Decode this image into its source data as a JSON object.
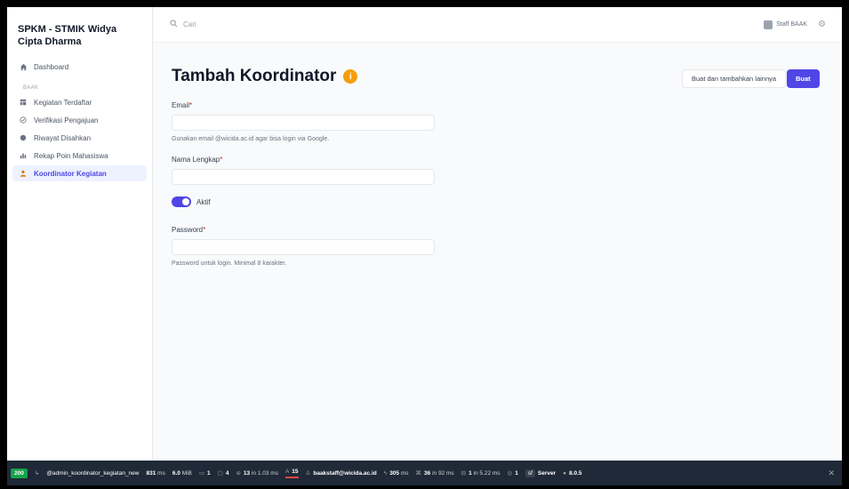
{
  "app": {
    "brand": "SPKM - STMIK Widya Cipta Dharma"
  },
  "sidebar": {
    "dashboard": "Dashboard",
    "group": "BAAK",
    "items": [
      {
        "label": "Kegiatan Terdaftar",
        "icon": "table-icon"
      },
      {
        "label": "Verifikasi Pengajuan",
        "icon": "check-badge-icon"
      },
      {
        "label": "Riwayat Disahkan",
        "icon": "history-icon"
      },
      {
        "label": "Rekap Poin Mahasiswa",
        "icon": "bar-chart-icon"
      },
      {
        "label": "Koordinator Kegiatan",
        "icon": "user-icon",
        "active": true
      }
    ]
  },
  "topbar": {
    "search_placeholder": "Cari",
    "user_name": "Staff BAAK"
  },
  "page": {
    "title": "Tambah Koordinator",
    "btn_create_another": "Buat dan tambahkan lainnya",
    "btn_create": "Buat",
    "email_label": "Email",
    "email_hint": "Gunakan email @wicida.ac.id agar bisa login via Google.",
    "name_label": "Nama Lengkap",
    "toggle_label": "Aktif",
    "toggle_on": true,
    "password_label": "Password",
    "password_hint": "Password untuk login. Minimal 8 karakter."
  },
  "debugbar": {
    "status": "200",
    "route": "@admin_koordinator_kegiatan_new",
    "time": "831",
    "time_unit": "ms",
    "memory": "6.0",
    "memory_unit": "MiB",
    "forms": "1",
    "twig": "4",
    "cache": "13",
    "cache_detail": "in 1.03 ms",
    "translation": "15",
    "user": "baakstaff@wicida.ac.id",
    "init": "305",
    "init_unit": "ms",
    "events": "36",
    "events_detail": "in 92 ms",
    "db": "1",
    "db_detail": "in 5.22 ms",
    "http": "1",
    "server": "Server",
    "version": "8.0.5",
    "status_color": "#16a34a"
  }
}
